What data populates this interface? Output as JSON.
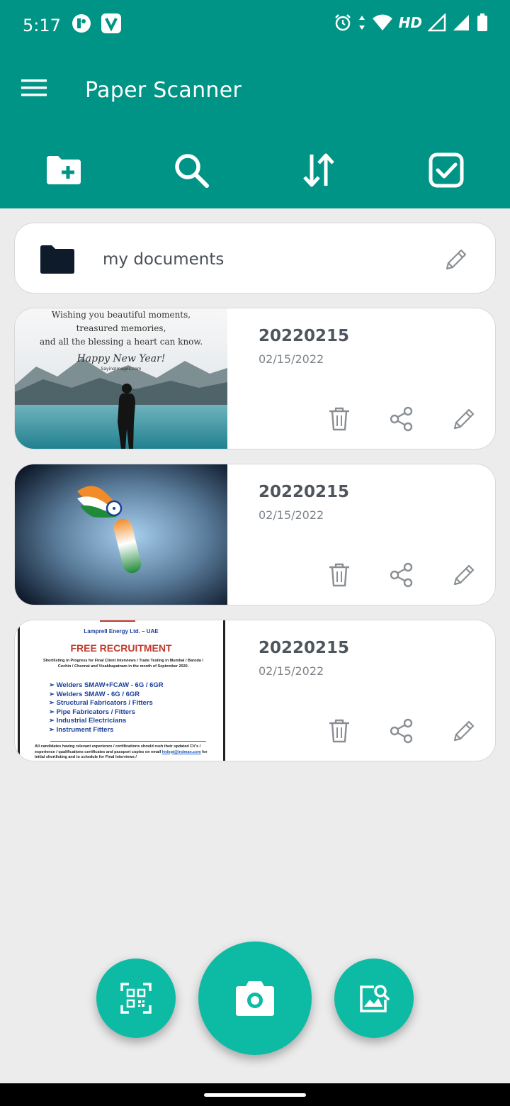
{
  "status_bar": {
    "time": "5:17",
    "network_label": "HD",
    "signal_badge": "4"
  },
  "app_bar": {
    "title": "Paper Scanner"
  },
  "toolbar": {
    "actions": [
      "new-folder-icon",
      "search-icon",
      "sort-icon",
      "select-all-icon"
    ]
  },
  "folder": {
    "name": "my documents"
  },
  "documents": [
    {
      "title": "20220215",
      "date": "02/15/2022",
      "thumbnail": {
        "lines": [
          "Wishing you beautiful moments,",
          "treasured memories,",
          "and all the blessing a heart can know."
        ],
        "greeting": "Happy New Year!",
        "credit": "SayingImages.com"
      }
    },
    {
      "title": "20220215",
      "date": "02/15/2022"
    },
    {
      "title": "20220215",
      "date": "02/15/2022",
      "thumbnail": {
        "company": "Lamprell Energy Ltd. – UAE",
        "headline": "FREE RECRUITMENT",
        "intro": "Shortlisting in Progress for Final Client Interviews / Trade Testing in Mumbai / Baroda / Cochin / Chennai and Visakhapatnam in the month of September 2020.",
        "roles": [
          "Welders SMAW+FCAW - 6G / 6GR",
          "Welders SMAW - 6G / 6GR",
          "Structural Fabricators / Fitters",
          "Pipe Fabricators / Fitters",
          "Industrial Electricians",
          "Instrument Fitters"
        ],
        "footer": "All candidates having relevant experience / certifications should rush their updated CV's / experience / qualifications certificates and passport copies on email",
        "email": "hrdept@indman.com",
        "footer_tail": "for initial shortlisting and to schedule for Final Interviews /"
      }
    }
  ],
  "colors": {
    "primary": "#009486",
    "fab": "#0dbba4",
    "background": "#ececec"
  }
}
